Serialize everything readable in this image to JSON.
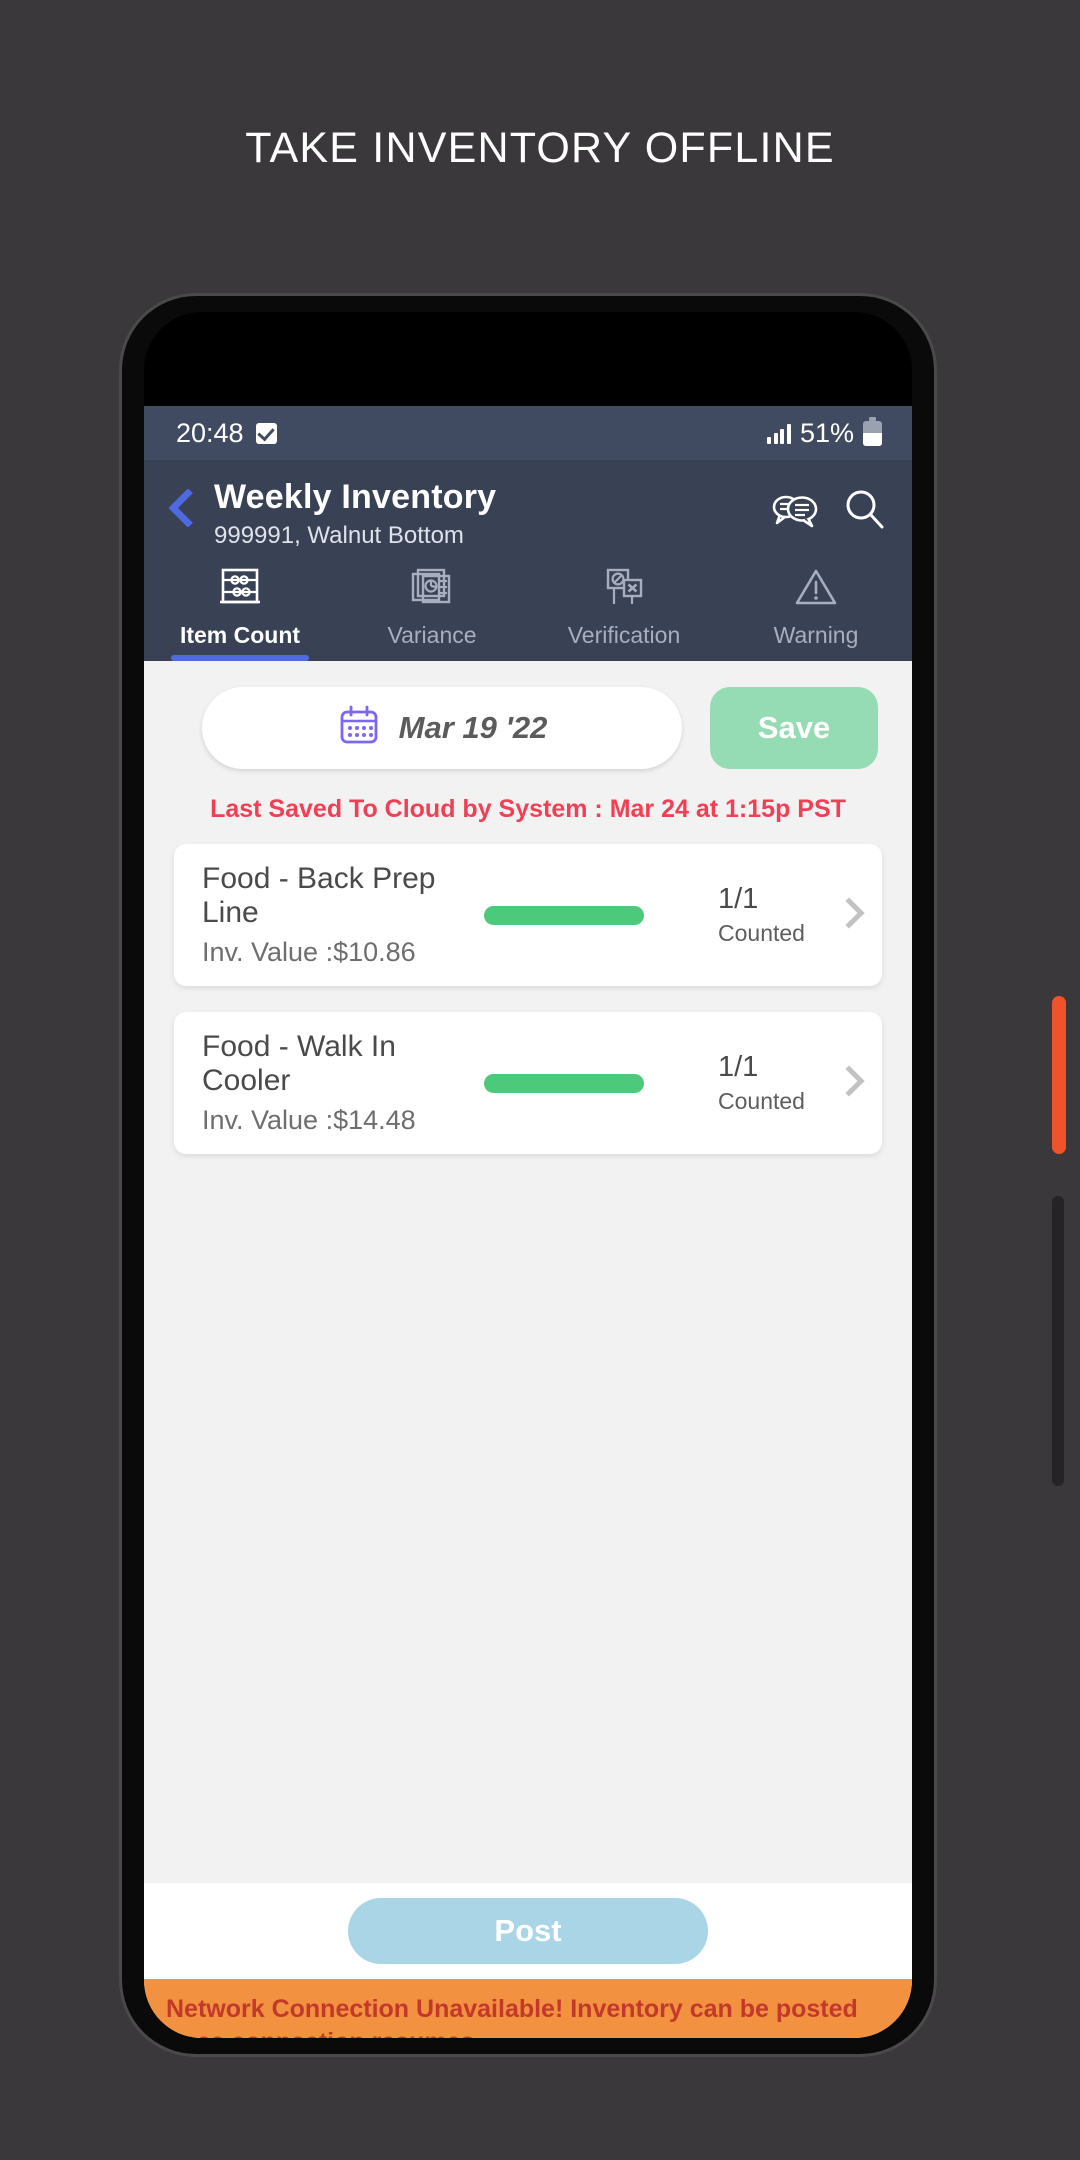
{
  "poster": {
    "title": "TAKE INVENTORY OFFLINE"
  },
  "statusbar": {
    "time": "20:48",
    "check_icon": "checkbox-checked-icon",
    "signal_icon": "signal-bars-icon",
    "battery_percent": "51%",
    "battery_icon": "battery-icon"
  },
  "appbar": {
    "back_icon": "back-chevron-icon",
    "title": "Weekly Inventory",
    "subtitle": "999991, Walnut Bottom",
    "chat_icon": "chat-bubbles-icon",
    "search_icon": "search-icon"
  },
  "tabs": [
    {
      "label": "Item Count",
      "icon": "abacus-icon",
      "active": true
    },
    {
      "label": "Variance",
      "icon": "report-chart-icon",
      "active": false
    },
    {
      "label": "Verification",
      "icon": "signboards-icon",
      "active": false
    },
    {
      "label": "Warning",
      "icon": "warning-triangle-icon",
      "active": false
    }
  ],
  "toolbar": {
    "calendar_icon": "calendar-icon",
    "date_value": "Mar 19 '22",
    "save_label": "Save"
  },
  "last_saved": "Last Saved To Cloud by System :  Mar 24 at 1:15p PST",
  "cards": [
    {
      "title": "Food - Back Prep Line",
      "subtitle": "Inv. Value :$10.86",
      "progress_percent": 100,
      "count": "1/1",
      "count_label": "Counted",
      "chevron_icon": "chevron-right-icon"
    },
    {
      "title": "Food - Walk In Cooler",
      "subtitle": "Inv. Value :$14.48",
      "progress_percent": 100,
      "count": "1/1",
      "count_label": "Counted",
      "chevron_icon": "chevron-right-icon"
    }
  ],
  "footer": {
    "post_label": "Post"
  },
  "banner": {
    "message": "Network Connection Unavailable! Inventory can be posted once connection resumes"
  },
  "navbar": {
    "recents_icon": "recents-icon",
    "home_icon": "home-icon",
    "back_icon": "nav-back-icon"
  },
  "colors": {
    "page_bg": "#3a383a",
    "appbar": "#394155",
    "statusbar": "#404a61",
    "accent_blue": "#4f6ae0",
    "save_green": "#95dcb4",
    "progress_green": "#4cc97a",
    "post_blue": "#a9d5e6",
    "banner_orange": "#f2913f",
    "banner_text": "#c2392b",
    "alert_red": "#ef4056",
    "calendar_purple": "#7b68ee",
    "side_button_orange": "#f0522c"
  }
}
